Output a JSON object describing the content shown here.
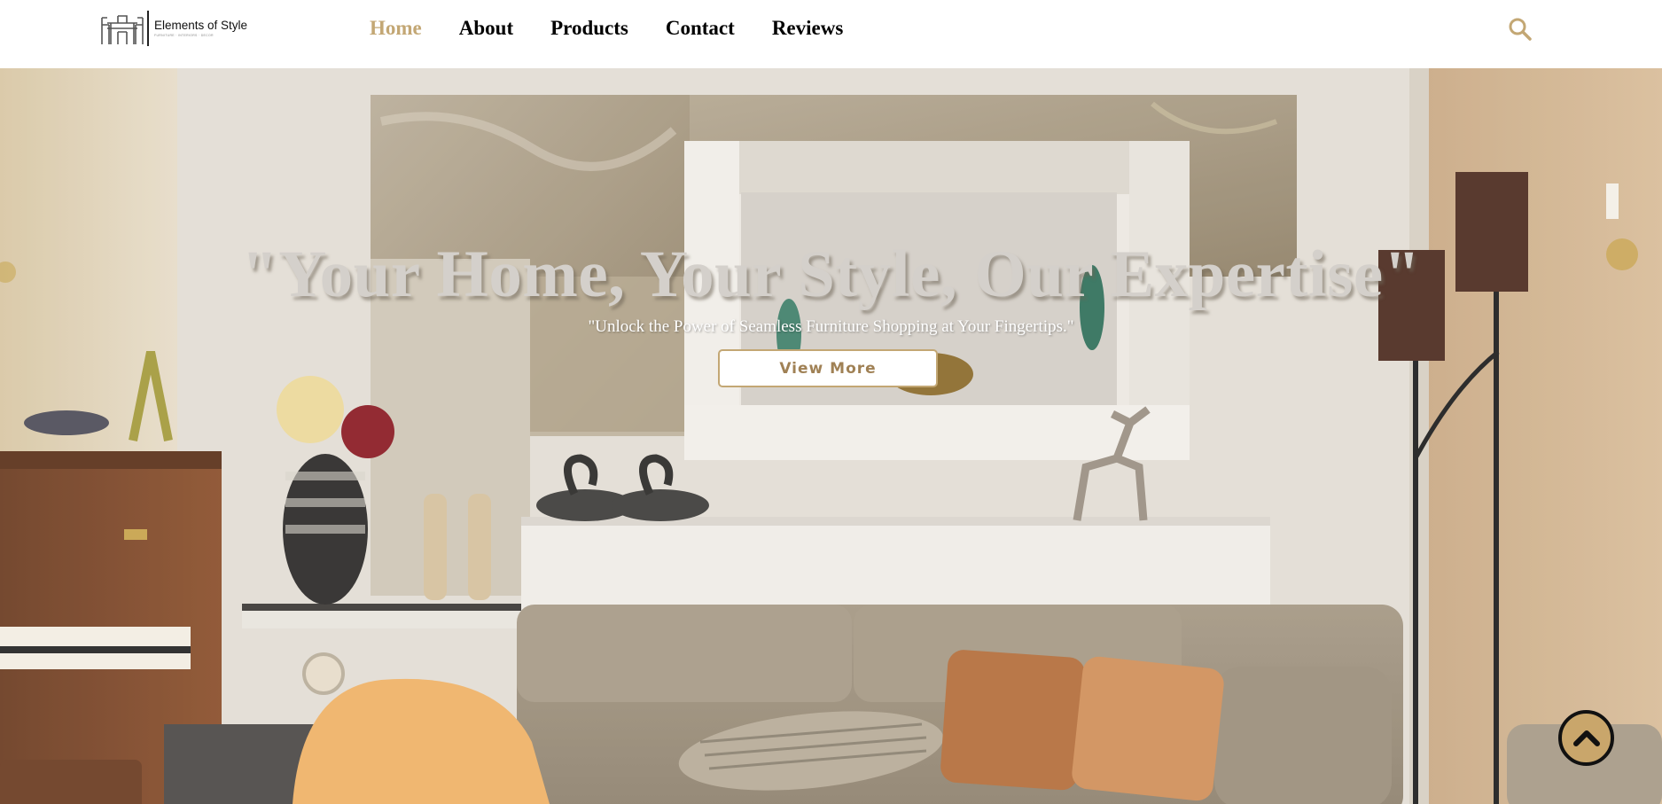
{
  "brand": {
    "name": "Elements of Style",
    "tagline": "FURNITURE · INTERIORS · DECOR"
  },
  "nav": {
    "items": [
      {
        "label": "Home",
        "active": true
      },
      {
        "label": "About",
        "active": false
      },
      {
        "label": "Products",
        "active": false
      },
      {
        "label": "Contact",
        "active": false
      },
      {
        "label": "Reviews",
        "active": false
      }
    ]
  },
  "header": {
    "search_icon": "search-icon"
  },
  "hero": {
    "title": "\"Your Home, Your Style, Our Expertise\"",
    "subtitle": "\"Unlock the Power of Seamless Furniture Shopping at Your Fingertips.\"",
    "cta_label": "View More",
    "background": "living-room-photo"
  },
  "back_to_top": {
    "icon": "chevron-up-icon"
  },
  "colors": {
    "accent": "#c3a774",
    "cta_text": "#a08155",
    "back_to_top_bg": "#c9a66b",
    "nav_text": "#000000"
  }
}
